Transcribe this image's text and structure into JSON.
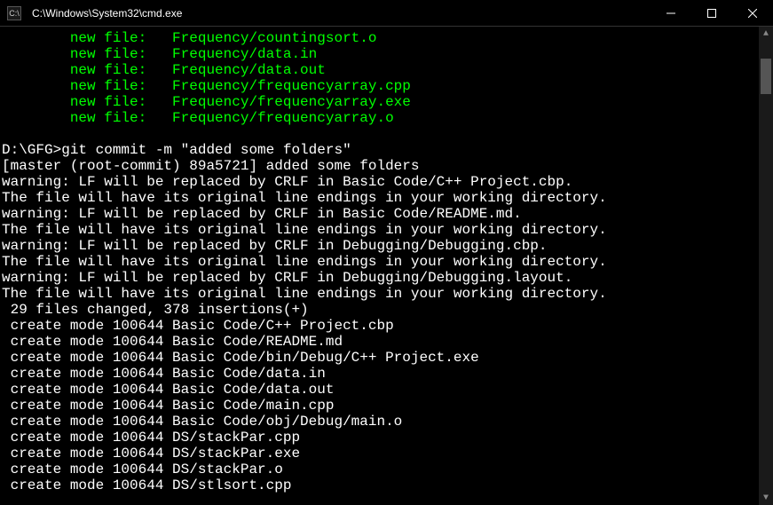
{
  "window": {
    "title": "C:\\Windows\\System32\\cmd.exe",
    "icon_label": "C:\\"
  },
  "staged": {
    "indent": "        ",
    "label": "new file:   ",
    "files": [
      "Frequency/countingsort.o",
      "Frequency/data.in",
      "Frequency/data.out",
      "Frequency/frequencyarray.cpp",
      "Frequency/frequencyarray.exe",
      "Frequency/frequencyarray.o"
    ]
  },
  "prompt": {
    "path": "D:\\GFG>",
    "command": "git commit -m \"added some folders\""
  },
  "commit_out": [
    "[master (root-commit) 89a5721] added some folders",
    "warning: LF will be replaced by CRLF in Basic Code/C++ Project.cbp.",
    "The file will have its original line endings in your working directory.",
    "warning: LF will be replaced by CRLF in Basic Code/README.md.",
    "The file will have its original line endings in your working directory.",
    "warning: LF will be replaced by CRLF in Debugging/Debugging.cbp.",
    "The file will have its original line endings in your working directory.",
    "warning: LF will be replaced by CRLF in Debugging/Debugging.layout.",
    "The file will have its original line endings in your working directory.",
    " 29 files changed, 378 insertions(+)",
    " create mode 100644 Basic Code/C++ Project.cbp",
    " create mode 100644 Basic Code/README.md",
    " create mode 100644 Basic Code/bin/Debug/C++ Project.exe",
    " create mode 100644 Basic Code/data.in",
    " create mode 100644 Basic Code/data.out",
    " create mode 100644 Basic Code/main.cpp",
    " create mode 100644 Basic Code/obj/Debug/main.o",
    " create mode 100644 DS/stackPar.cpp",
    " create mode 100644 DS/stackPar.exe",
    " create mode 100644 DS/stackPar.o",
    " create mode 100644 DS/stlsort.cpp"
  ]
}
